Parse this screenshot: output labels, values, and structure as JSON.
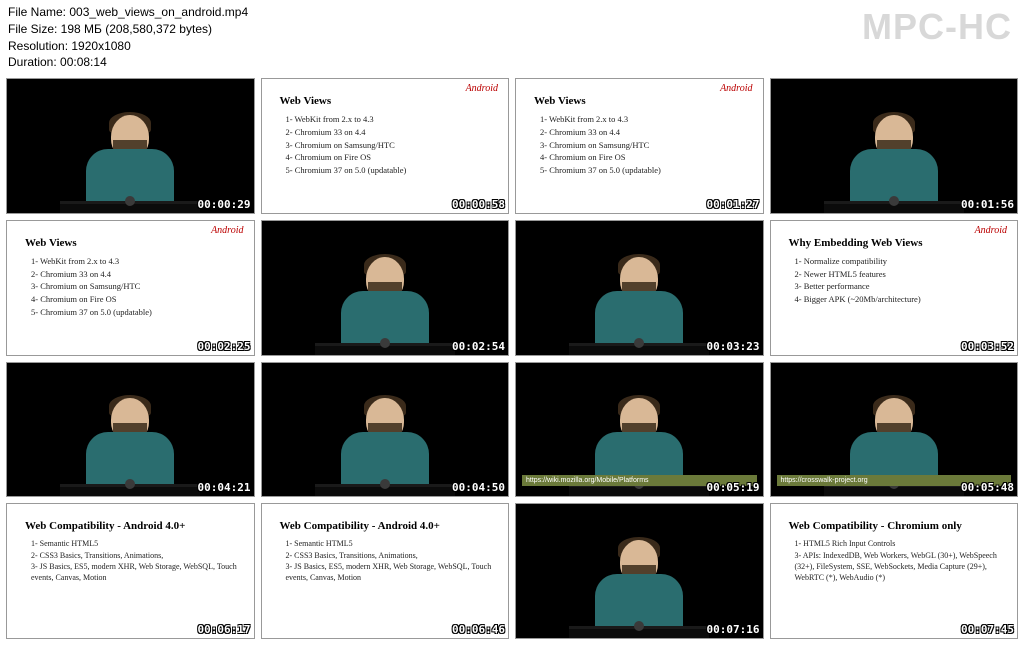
{
  "brand": "MPC-HC",
  "meta": {
    "fileName": "File Name: 003_web_views_on_android.mp4",
    "fileSize": "File Size: 198 МБ (208,580,372 bytes)",
    "resolution": "Resolution: 1920x1080",
    "duration": "Duration: 00:08:14"
  },
  "slides": {
    "android": "Android",
    "webviews_title": "Web Views",
    "webviews_items": [
      "1- WebKit from 2.x to 4.3",
      "2- Chromium 33 on 4.4",
      "3- Chromium on Samsung/HTC",
      "4- Chromium on Fire OS",
      "5- Chromium 37 on 5.0 (updatable)"
    ],
    "embed_title": "Why Embedding Web Views",
    "embed_items": [
      "1- Normalize compatibility",
      "2- Newer HTML5 features",
      "3- Better performance",
      "4- Bigger APK (~20Mb/architecture)"
    ],
    "compat4_title": "Web Compatibility - Android 4.0+",
    "compat4_items": [
      "1- Semantic HTML5",
      "2- CSS3 Basics, Transitions, Animations,",
      "3- JS Basics, ES5, modern XHR, Web Storage, WebSQL, Touch events, Canvas, Motion"
    ],
    "compatc_title": "Web Compatibility - Chromium only",
    "compatc_items": [
      "1- HTML5 Rich Input Controls",
      "3- APIs: IndexedDB, Web Workers, WebGL (30+), WebSpeech (32+), FileSystem, SSE, WebSockets, Media Capture (29+), WebRTC (*), WebAudio (*)"
    ]
  },
  "lower1": "https://wiki.mozilla.org/Mobile/Platforms",
  "lower2": "https://crosswalk-project.org",
  "ts": [
    "00:00:29",
    "00:00:58",
    "00:01:27",
    "00:01:56",
    "00:02:25",
    "00:02:54",
    "00:03:23",
    "00:03:52",
    "00:04:21",
    "00:04:50",
    "00:05:19",
    "00:05:48",
    "00:06:17",
    "00:06:46",
    "00:07:16",
    "00:07:45"
  ]
}
